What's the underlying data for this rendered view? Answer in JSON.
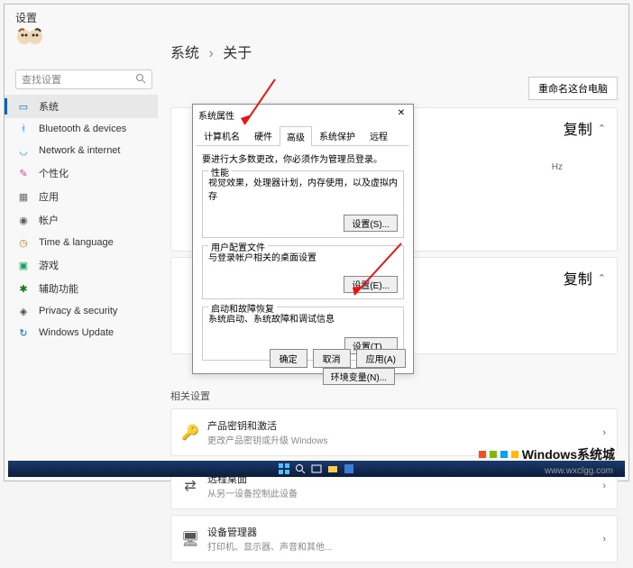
{
  "header": {
    "title": "设置"
  },
  "search": {
    "placeholder": "查找设置",
    "icon": "search-icon"
  },
  "sidebar": {
    "items": [
      {
        "label": "系统",
        "selected": true,
        "color": "#0067c0"
      },
      {
        "label": "Bluetooth & devices",
        "color": "#0a84ff"
      },
      {
        "label": "Network & internet",
        "color": "#18a0b8"
      },
      {
        "label": "个性化",
        "color": "#d83b9c"
      },
      {
        "label": "应用",
        "color": "#6b6b6b"
      },
      {
        "label": "帐户",
        "color": "#5c5c5c"
      },
      {
        "label": "Time & language",
        "color": "#c47a00"
      },
      {
        "label": "游戏",
        "color": "#1aa061"
      },
      {
        "label": "辅助功能",
        "color": "#107c10"
      },
      {
        "label": "Privacy & security",
        "color": "#4a4a4a"
      },
      {
        "label": "Windows Update",
        "color": "#0067c0"
      }
    ]
  },
  "breadcrumb": {
    "a": "系统",
    "sep": "›",
    "b": "关于"
  },
  "rename": "重命名这台电脑",
  "cards_top": [
    {
      "copy_label": "复制",
      "chev": "⌃",
      "hz": "Hz"
    }
  ],
  "related_label": "相关设置",
  "cards_bottom": [
    {
      "title": "产品密钥和激活",
      "sub": "更改产品密钥或升级 Windows",
      "chev": "›"
    },
    {
      "title": "远程桌面",
      "sub": "从另一设备控制此设备",
      "chev": "›"
    },
    {
      "title": "设备管理器",
      "sub": "打印机、显示器、声音和其他...",
      "chev": "›"
    }
  ],
  "dialog": {
    "title": "系统属性",
    "tabs": [
      "计算机名",
      "硬件",
      "高级",
      "系统保护",
      "远程"
    ],
    "active_tab": 2,
    "note": "要进行大多数更改，你必须作为管理员登录。",
    "groups": [
      {
        "label": "性能",
        "desc": "视觉效果，处理器计划，内存使用，以及虚拟内存",
        "btn": "设置(S)..."
      },
      {
        "label": "用户配置文件",
        "desc": "与登录帐户相关的桌面设置",
        "btn": "设置(E)..."
      },
      {
        "label": "启动和故障恢复",
        "desc": "系统启动、系统故障和调试信息",
        "btn": "设置(T)..."
      }
    ],
    "env_btn": "环境变量(N)...",
    "ok": "确定",
    "cancel": "取消",
    "apply": "应用(A)"
  },
  "watermark": {
    "text": "Windows系统城",
    "url": "www.wxclgg.com"
  },
  "colors": {
    "accent": "#0067c0",
    "arrow": "#e11"
  }
}
